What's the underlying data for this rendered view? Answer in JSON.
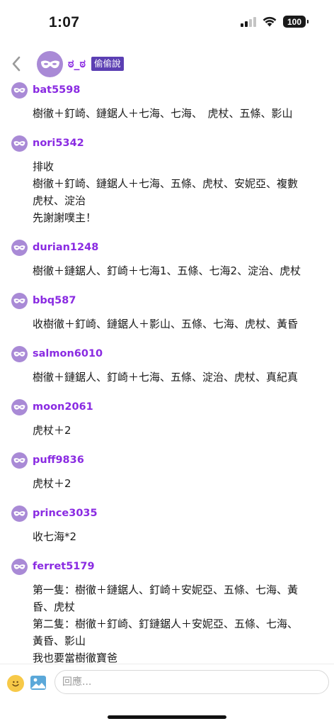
{
  "status_bar": {
    "time": "1:07",
    "battery": "100"
  },
  "header": {
    "name": "ಠ_ಠ",
    "badge": "偷偷說"
  },
  "colors": {
    "accent": "#8a2be2",
    "avatar_bg": "#a98ad6",
    "badge_bg": "#5b3fb3"
  },
  "icons": {
    "back": "chevron-left-icon",
    "avatar": "mask-icon",
    "emoji": "smiley-icon",
    "image": "image-icon"
  },
  "comments": [
    {
      "user": "bat5598",
      "lines": [
        "樹徹＋釘崎、鏈鋸人＋七海、七海、　虎杖、五條、影山"
      ]
    },
    {
      "user": "nori5342",
      "lines": [
        "排收",
        "樹徹＋釘崎、鏈鋸人＋七海、五條、虎杖、安妮亞、複數",
        "虎杖、淀治",
        "先謝謝噗主！"
      ]
    },
    {
      "user": "durian1248",
      "lines": [
        "樹徹＋鏈鋸人、釘崎＋七海1、五條、七海2、淀治、虎杖"
      ]
    },
    {
      "user": "bbq587",
      "lines": [
        "收樹徹＋釘崎、鏈鋸人＋影山、五條、七海、虎杖、黃昏"
      ]
    },
    {
      "user": "salmon6010",
      "lines": [
        "樹徹＋鏈鋸人、釘崎＋七海、五條、淀治、虎杖、真紀真"
      ]
    },
    {
      "user": "moon2061",
      "lines": [
        "虎杖＋2"
      ]
    },
    {
      "user": "puff9836",
      "lines": [
        "虎杖＋2"
      ]
    },
    {
      "user": "prince3035",
      "lines": [
        "收七海*2"
      ]
    },
    {
      "user": "ferret5179",
      "lines": [
        "第一隻：樹徹＋鏈鋸人、釘崎＋安妮亞、五條、七海、黃",
        "昏、虎杖",
        "第二隻：樹徹＋釘崎、釘鏈鋸人＋安妮亞、五條、七海、",
        "黃昏、影山"
      ]
    },
    {
      "user": "",
      "lines": [
        "我也要當樹徹寶爸"
      ]
    }
  ],
  "reply": {
    "placeholder": "回應..."
  }
}
